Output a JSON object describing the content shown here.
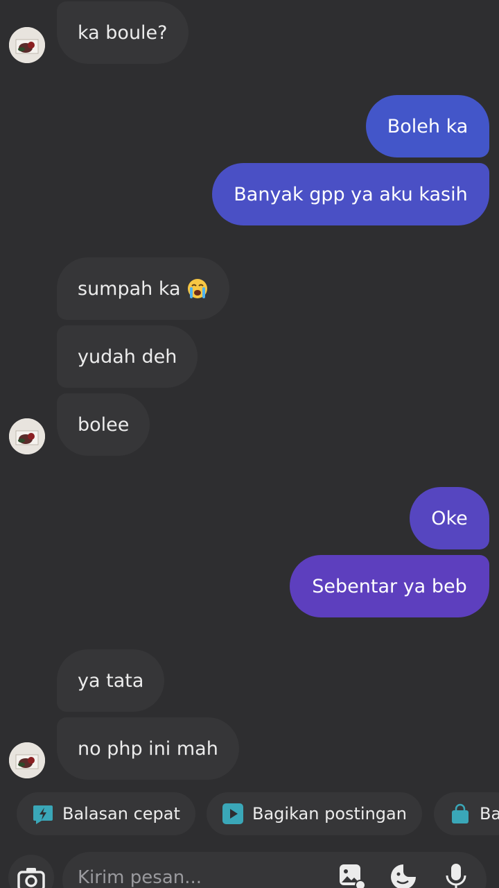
{
  "messages": [
    {
      "side": "in",
      "text": "ka boule?"
    },
    {
      "side": "out",
      "text": "Boleh ka"
    },
    {
      "side": "out",
      "text": "Banyak gpp ya aku kasih"
    },
    {
      "side": "in",
      "text": "sumpah ka",
      "emoji": "loudly-crying-face"
    },
    {
      "side": "in",
      "text": "yudah deh"
    },
    {
      "side": "in",
      "text": "bolee"
    },
    {
      "side": "out",
      "text": "Oke"
    },
    {
      "side": "out",
      "text": "Sebentar ya beb"
    },
    {
      "side": "in",
      "text": "ya tata"
    },
    {
      "side": "in",
      "text": "no php ini mah"
    }
  ],
  "quick_actions": [
    {
      "label": "Balasan cepat",
      "icon": "lightning-bubble-icon"
    },
    {
      "label": "Bagikan postingan",
      "icon": "play-icon"
    },
    {
      "label": "Ba",
      "icon": "shopping-bag-icon"
    }
  ],
  "composer": {
    "placeholder": "Kirim pesan..."
  },
  "colors": {
    "background": "#2e2e30",
    "incoming_bubble": "#363638",
    "outgoing_gradient_top": "#4356c9",
    "outgoing_gradient_bottom": "#5d3fbe",
    "chip_icon": "#3aa7b8"
  }
}
